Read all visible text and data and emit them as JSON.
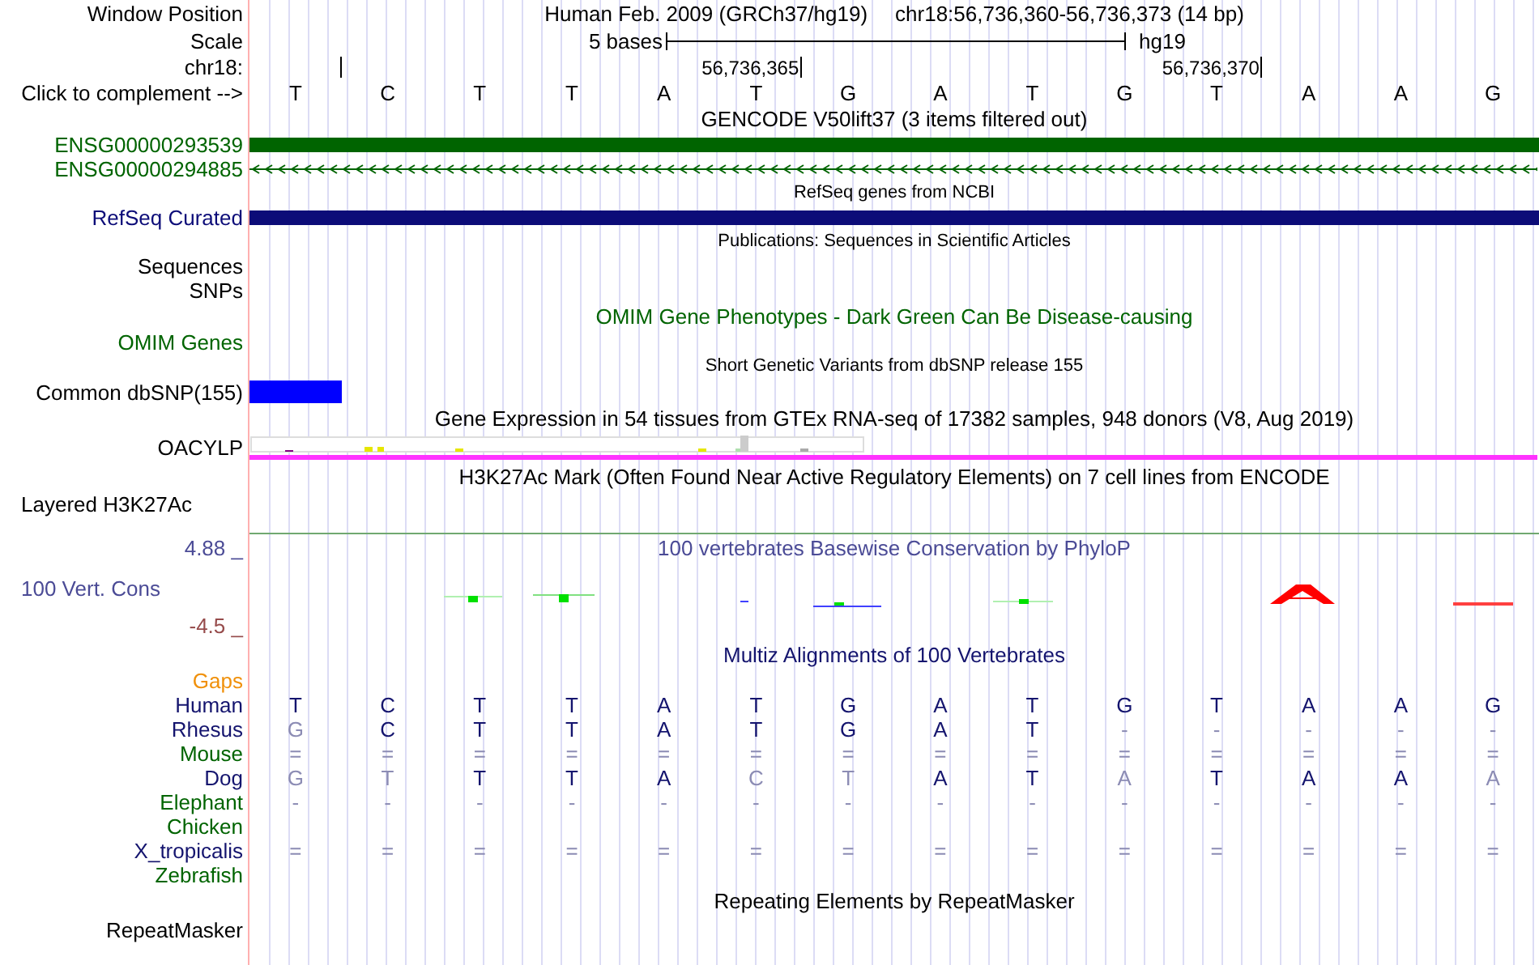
{
  "position": {
    "label": "Window Position",
    "assembly": "Human Feb. 2009 (GRCh37/hg19)",
    "range": "chr18:56,736,360-56,736,373 (14 bp)"
  },
  "scale": {
    "label": "Scale",
    "span": "5 bases",
    "db": "hg19"
  },
  "coordinates": {
    "label": "chr18:",
    "marks": [
      "56,736,365",
      "56,736,370"
    ]
  },
  "sequence": {
    "label": "Click to complement -->",
    "bases": [
      "T",
      "C",
      "T",
      "T",
      "A",
      "T",
      "G",
      "A",
      "T",
      "G",
      "T",
      "A",
      "A",
      "G"
    ]
  },
  "tracks": [
    {
      "kind": "title",
      "text": "GENCODE V50lift37 (3 items filtered out)",
      "color": "#000000"
    },
    {
      "kind": "bar",
      "label": "ENSG00000293539",
      "color": "#006400"
    },
    {
      "kind": "arrows",
      "label": "ENSG00000294885",
      "color": "#006400"
    },
    {
      "kind": "note",
      "text": "RefSeq genes from NCBI",
      "color": "#000000"
    },
    {
      "kind": "bar",
      "label": "RefSeq Curated",
      "color": "#0c0c78"
    },
    {
      "kind": "note",
      "text": "Publications: Sequences in Scientific Articles",
      "color": "#000000"
    },
    {
      "kind": "label",
      "label": "Sequences",
      "color": "#000000"
    },
    {
      "kind": "label",
      "label": "SNPs",
      "color": "#000000"
    },
    {
      "kind": "title",
      "text": "OMIM Gene Phenotypes - Dark Green Can Be Disease-causing",
      "color": "#006400"
    },
    {
      "kind": "label",
      "label": "OMIM Genes",
      "color": "#006400"
    },
    {
      "kind": "note",
      "text": "Short Genetic Variants from dbSNP release 155",
      "color": "#000000"
    },
    {
      "kind": "snp",
      "label": "Common dbSNP(155)",
      "color": "#000000"
    },
    {
      "kind": "title",
      "text": "Gene Expression in 54 tissues from GTEx RNA-seq of 17382 samples, 948 donors (V8, Aug 2019)",
      "color": "#000000"
    },
    {
      "kind": "expression",
      "label": "OACYLP",
      "color": "#000000"
    },
    {
      "kind": "title",
      "text": "H3K27Ac Mark (Often Found Near Active Regulatory Elements) on 7 cell lines from ENCODE",
      "color": "#000000"
    },
    {
      "kind": "signal",
      "label": "Layered H3K27Ac",
      "color": "#000000"
    },
    {
      "kind": "conservation",
      "title": "100 vertebrates Basewise Conservation by PhyloP",
      "label": "100 Vert. Cons",
      "max": "4.88 _",
      "min": "-4.5 _"
    },
    {
      "kind": "title",
      "text": "Multiz Alignments of 100 Vertebrates",
      "color": "#14146e"
    },
    {
      "kind": "alignment",
      "gaps_label": "Gaps",
      "species": [
        {
          "name": "Human",
          "color": "#14146e",
          "bases": [
            {
              "text": "T",
              "matches": true
            },
            {
              "text": "C",
              "matches": true
            },
            {
              "text": "T",
              "matches": true
            },
            {
              "text": "T",
              "matches": true
            },
            {
              "text": "A",
              "matches": true
            },
            {
              "text": "T",
              "matches": true
            },
            {
              "text": "G",
              "matches": true
            },
            {
              "text": "A",
              "matches": true
            },
            {
              "text": "T",
              "matches": true
            },
            {
              "text": "G",
              "matches": true
            },
            {
              "text": "T",
              "matches": true
            },
            {
              "text": "A",
              "matches": true
            },
            {
              "text": "A",
              "matches": true
            },
            {
              "text": "G",
              "matches": true
            }
          ]
        },
        {
          "name": "Rhesus",
          "color": "#14146e",
          "bases": [
            {
              "text": "G",
              "matches": false
            },
            {
              "text": "C",
              "matches": true
            },
            {
              "text": "T",
              "matches": true
            },
            {
              "text": "T",
              "matches": true
            },
            {
              "text": "A",
              "matches": true
            },
            {
              "text": "T",
              "matches": true
            },
            {
              "text": "G",
              "matches": true
            },
            {
              "text": "A",
              "matches": true
            },
            {
              "text": "T",
              "matches": true
            },
            {
              "text": "-",
              "matches": false
            },
            {
              "text": "-",
              "matches": false
            },
            {
              "text": "-",
              "matches": false
            },
            {
              "text": "-",
              "matches": false
            },
            {
              "text": "-",
              "matches": false
            }
          ]
        },
        {
          "name": "Mouse",
          "color": "#006400",
          "bases": [
            {
              "text": "=",
              "matches": false
            },
            {
              "text": "=",
              "matches": false
            },
            {
              "text": "=",
              "matches": false
            },
            {
              "text": "=",
              "matches": false
            },
            {
              "text": "=",
              "matches": false
            },
            {
              "text": "=",
              "matches": false
            },
            {
              "text": "=",
              "matches": false
            },
            {
              "text": "=",
              "matches": false
            },
            {
              "text": "=",
              "matches": false
            },
            {
              "text": "=",
              "matches": false
            },
            {
              "text": "=",
              "matches": false
            },
            {
              "text": "=",
              "matches": false
            },
            {
              "text": "=",
              "matches": false
            },
            {
              "text": "=",
              "matches": false
            }
          ]
        },
        {
          "name": "Dog",
          "color": "#14146e",
          "bases": [
            {
              "text": "G",
              "matches": false
            },
            {
              "text": "T",
              "matches": false
            },
            {
              "text": "T",
              "matches": true
            },
            {
              "text": "T",
              "matches": true
            },
            {
              "text": "A",
              "matches": true
            },
            {
              "text": "C",
              "matches": false
            },
            {
              "text": "T",
              "matches": false
            },
            {
              "text": "A",
              "matches": true
            },
            {
              "text": "T",
              "matches": true
            },
            {
              "text": "A",
              "matches": false
            },
            {
              "text": "T",
              "matches": true
            },
            {
              "text": "A",
              "matches": true
            },
            {
              "text": "A",
              "matches": true
            },
            {
              "text": "A",
              "matches": false
            }
          ]
        },
        {
          "name": "Elephant",
          "color": "#006400",
          "bases": [
            {
              "text": "-",
              "matches": false
            },
            {
              "text": "-",
              "matches": false
            },
            {
              "text": "-",
              "matches": false
            },
            {
              "text": "-",
              "matches": false
            },
            {
              "text": "-",
              "matches": false
            },
            {
              "text": "-",
              "matches": false
            },
            {
              "text": "-",
              "matches": false
            },
            {
              "text": "-",
              "matches": false
            },
            {
              "text": "-",
              "matches": false
            },
            {
              "text": "-",
              "matches": false
            },
            {
              "text": "-",
              "matches": false
            },
            {
              "text": "-",
              "matches": false
            },
            {
              "text": "-",
              "matches": false
            },
            {
              "text": "-",
              "matches": false
            }
          ]
        },
        {
          "name": "Chicken",
          "color": "#006400"
        },
        {
          "name": "X_tropicalis",
          "color": "#14146e",
          "bases": [
            {
              "text": "=",
              "matches": false
            },
            {
              "text": "=",
              "matches": false
            },
            {
              "text": "=",
              "matches": false
            },
            {
              "text": "=",
              "matches": false
            },
            {
              "text": "=",
              "matches": false
            },
            {
              "text": "=",
              "matches": false
            },
            {
              "text": "=",
              "matches": false
            },
            {
              "text": "=",
              "matches": false
            },
            {
              "text": "=",
              "matches": false
            },
            {
              "text": "=",
              "matches": false
            },
            {
              "text": "=",
              "matches": false
            },
            {
              "text": "=",
              "matches": false
            },
            {
              "text": "=",
              "matches": false
            },
            {
              "text": "=",
              "matches": false
            }
          ]
        },
        {
          "name": "Zebrafish",
          "color": "#006400"
        }
      ]
    },
    {
      "kind": "title",
      "text": "Repeating Elements by RepeatMasker",
      "color": "#000000"
    },
    {
      "kind": "label",
      "label": "RepeatMasker",
      "color": "#000000"
    }
  ]
}
